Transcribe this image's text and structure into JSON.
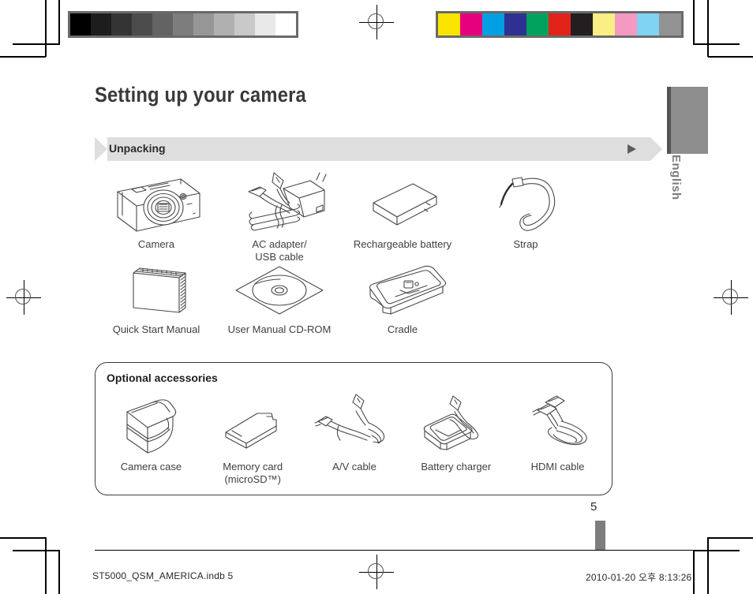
{
  "document": {
    "page_title": "Setting up your camera",
    "language_tab": "English",
    "page_number": "5"
  },
  "section": {
    "label": "Unpacking",
    "arrow_icon": "triangle-right-icon"
  },
  "included_items_row1": [
    {
      "caption": "Camera",
      "art": "camera-illustration"
    },
    {
      "caption": "AC adapter/\nUSB cable",
      "art": "ac-adapter-usb-cable-illustration"
    },
    {
      "caption": "Rechargeable battery",
      "art": "battery-illustration"
    },
    {
      "caption": "Strap",
      "art": "strap-illustration"
    }
  ],
  "included_items_row2": [
    {
      "caption": "Quick Start Manual",
      "art": "manual-illustration"
    },
    {
      "caption": "User Manual CD-ROM",
      "art": "cd-rom-illustration"
    },
    {
      "caption": "Cradle",
      "art": "cradle-illustration"
    }
  ],
  "optional": {
    "title": "Optional accessories",
    "items": [
      {
        "caption": "Camera case",
        "art": "camera-case-illustration"
      },
      {
        "caption": "Memory card\n(microSD™)",
        "art": "memory-card-illustration"
      },
      {
        "caption": "A/V cable",
        "art": "av-cable-illustration"
      },
      {
        "caption": "Battery charger",
        "art": "battery-charger-illustration"
      },
      {
        "caption": "HDMI cable",
        "art": "hdmi-cable-illustration"
      }
    ]
  },
  "footer": {
    "file_name": "ST5000_QSM_AMERICA.indb   5",
    "timestamp": "2010-01-20   오후 8:13:26"
  },
  "print_marks": {
    "grayscale_swatches": [
      "#000000",
      "#1d1d1d",
      "#343434",
      "#4c4c4c",
      "#636363",
      "#7d7d7d",
      "#969696",
      "#b0b0b0",
      "#c9c9c9",
      "#e9e9e9",
      "#ffffff"
    ],
    "color_swatches": [
      "#fbe500",
      "#e6007e",
      "#00a0e2",
      "#2e3191",
      "#00a25b",
      "#e2231a",
      "#231f20",
      "#faee84",
      "#f49ac2",
      "#81d3f3",
      "#939393"
    ]
  },
  "colors": {
    "section_bar_bg": "#dedede",
    "language_tab_bg": "#8e8e8e",
    "title_text": "#3a3a3a"
  }
}
